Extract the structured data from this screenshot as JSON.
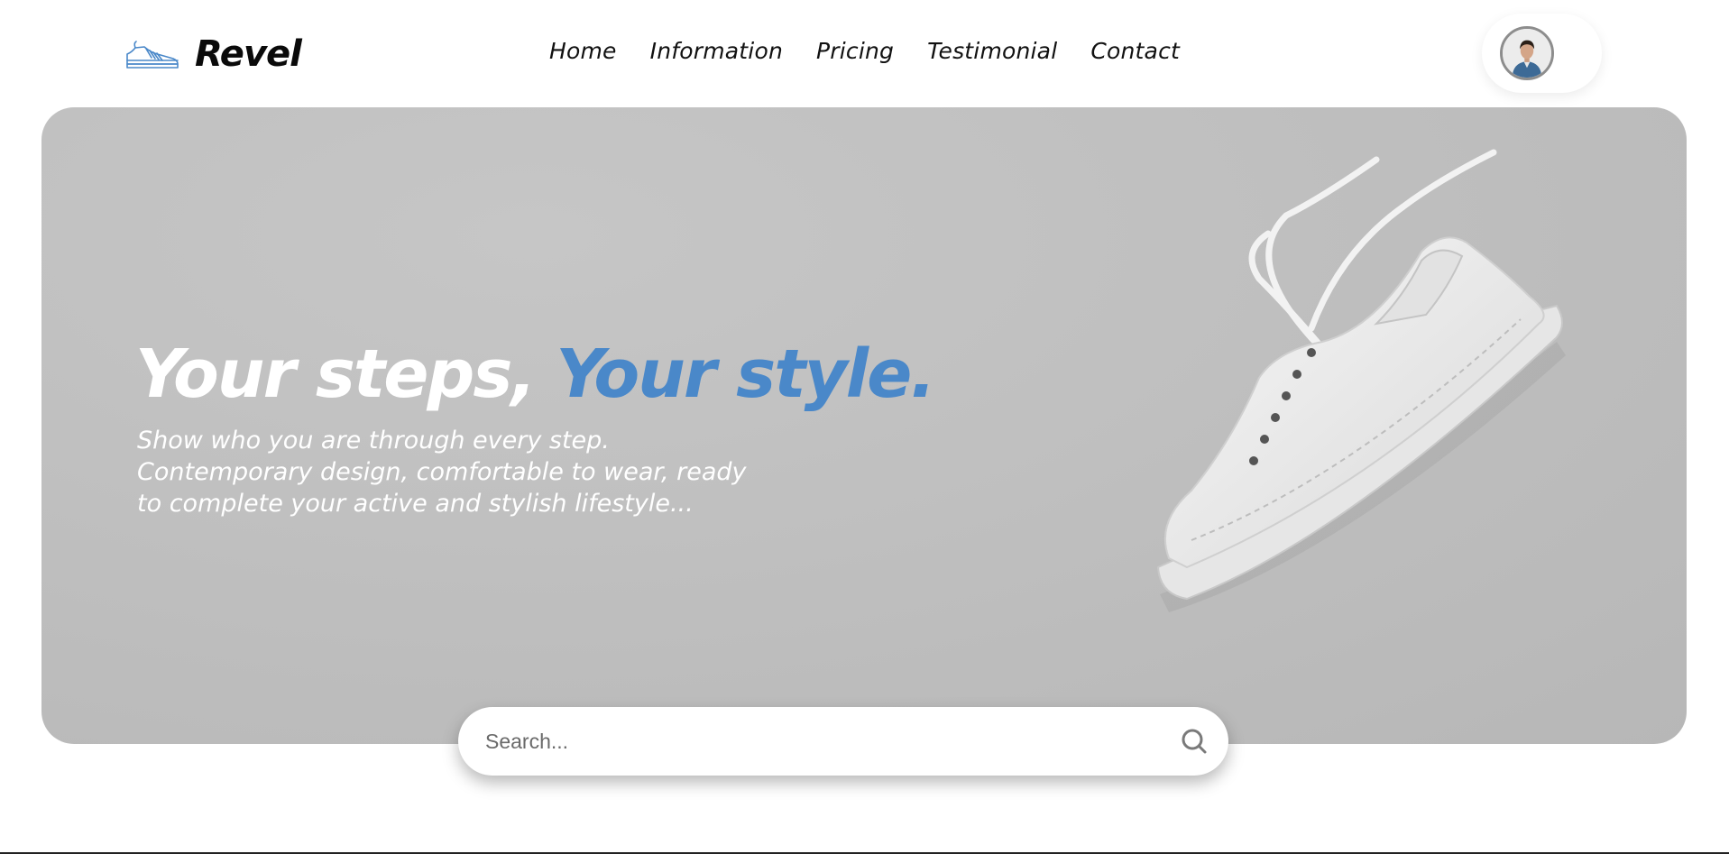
{
  "brand": {
    "name": "Revel",
    "accent": "#4a88c9"
  },
  "nav": {
    "items": [
      {
        "label": "Home"
      },
      {
        "label": "Information"
      },
      {
        "label": "Pricing"
      },
      {
        "label": "Testimonial"
      },
      {
        "label": "Contact"
      }
    ]
  },
  "user": {
    "avatar_icon": "user-avatar-icon"
  },
  "hero": {
    "title_part1": "Your steps,",
    "title_part2": "Your style.",
    "subtitle_lines": [
      "Show who you are through every step.",
      "Contemporary design, comfortable to wear, ready",
      "to complete your active and stylish lifestyle..."
    ],
    "image": "white-sneaker-icon"
  },
  "search": {
    "placeholder": "Search...",
    "value": "",
    "icon": "search-icon"
  }
}
